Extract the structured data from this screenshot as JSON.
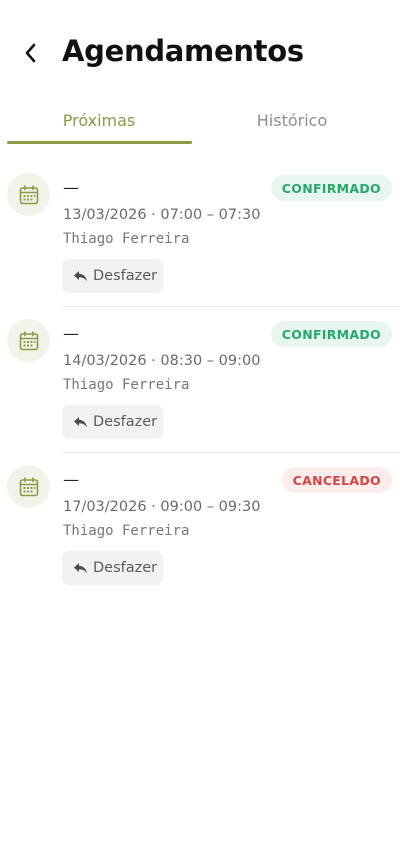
{
  "header": {
    "title": "Agendamentos"
  },
  "tabs": [
    {
      "label": "Próximas",
      "active": true
    },
    {
      "label": "Histórico",
      "active": false
    }
  ],
  "appointments": [
    {
      "title": "—",
      "status": "CONFIRMADO",
      "datetime": "13/03/2026 · 07:00 – 07:30",
      "person": "Thiago Ferreira",
      "action": "Desfazer"
    },
    {
      "title": "—",
      "status": "CONFIRMADO",
      "datetime": "14/03/2026 · 08:30 – 09:00",
      "person": "Thiago Ferreira",
      "action": "Desfazer"
    },
    {
      "title": "—",
      "status": "CANCELADO",
      "datetime": "17/03/2026 · 09:00 – 09:30",
      "person": "Thiago Ferreira",
      "action": "Desfazer"
    }
  ],
  "colors": {
    "accent": "#8a9a45",
    "confirmed": "#27a86b",
    "cancelled": "#d64545"
  },
  "icons": {
    "back": "back-arrow-icon",
    "calendar": "calendar-icon",
    "undo": "reply-icon"
  }
}
